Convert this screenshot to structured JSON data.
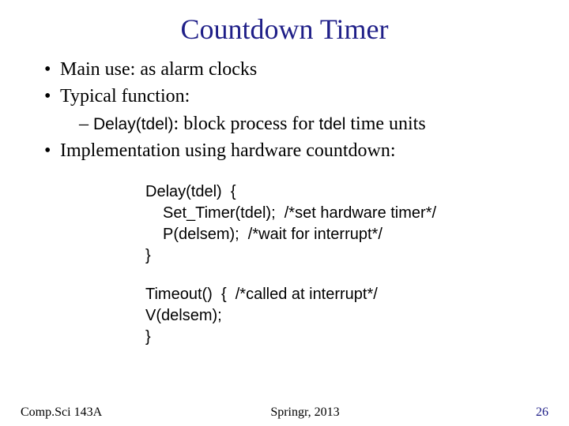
{
  "title": "Countdown Timer",
  "bullets": {
    "b1": "Main use: as alarm clocks",
    "b2": "Typical function:",
    "b2_sub_pre": "– ",
    "b2_sub_code": "Delay(tdel)",
    "b2_sub_mid": ": block process for ",
    "b2_sub_code2": "tdel",
    "b2_sub_post": " time units",
    "b3": "Implementation using hardware countdown:"
  },
  "code": {
    "l1": "Delay(tdel)  {",
    "l2": "Set_Timer(tdel);  /*set hardware timer*/",
    "l3": "P(delsem);  /*wait for interrupt*/",
    "l4": "}",
    "l5": "Timeout()  {  /*called at interrupt*/",
    "l6": "V(delsem);",
    "l7": "}"
  },
  "footer": {
    "left": "Comp.Sci 143A",
    "center": "Springr, 2013",
    "right": "26"
  }
}
